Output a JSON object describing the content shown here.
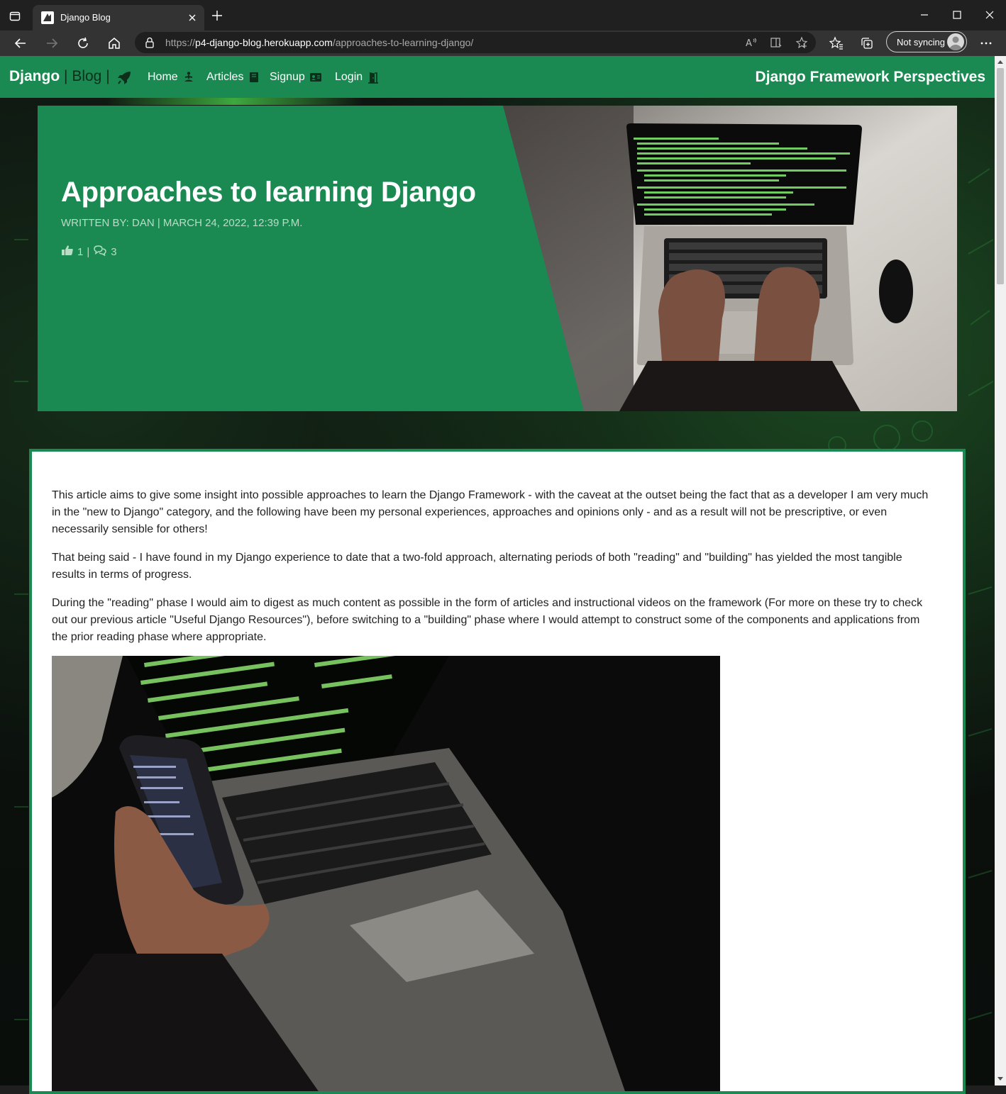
{
  "browser": {
    "tab_title": "Django Blog",
    "url_prefix": "https://",
    "url_host": "p4-django-blog.herokuapp.com",
    "url_path": "/approaches-to-learning-django/",
    "sync_label": "Not syncing"
  },
  "site": {
    "brand_name": "Django",
    "brand_sep": "|",
    "brand_blog": "Blog",
    "nav": [
      {
        "label": "Home",
        "icon": "meditation-icon"
      },
      {
        "label": "Articles",
        "icon": "book-icon"
      },
      {
        "label": "Signup",
        "icon": "id-card-icon"
      },
      {
        "label": "Login",
        "icon": "door-open-icon"
      }
    ],
    "tagline": "Django Framework Perspectives",
    "accent_color": "#1a8a52"
  },
  "post": {
    "title": "Approaches to learning Django",
    "meta": "WRITTEN BY: DAN | MARCH 24, 2022, 12:39 P.M.",
    "likes": "1",
    "stat_sep": "|",
    "comments": "3",
    "paragraphs": [
      "This article aims to give some insight into possible approaches to learn the Django Framework - with the caveat at the outset being the fact that as a developer I am very much in the \"new to Django\" category, and the following have been my personal experiences, approaches and opinions only - and as a result will not be prescriptive, or even necessarily sensible for others!",
      "That being said - I have found in my Django experience to date that a two-fold approach, alternating periods of both \"reading\" and \"building\" has yielded the most tangible results in terms of progress.",
      "During the \"reading\" phase I would aim to digest as much content as possible in the form of articles and instructional videos on the framework (For more on these try to check out our previous article \"Useful Django Resources\"), before switching to a \"building\" phase where I would attempt to construct some of the components and applications from the prior reading phase where appropriate."
    ]
  }
}
